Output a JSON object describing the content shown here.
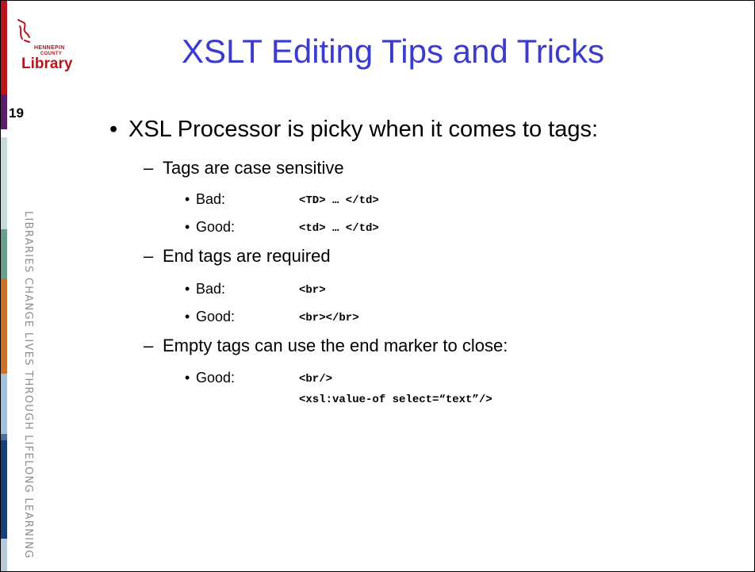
{
  "sidebar": {
    "logo": {
      "line1": "HENNEPIN",
      "line2": "COUNTY",
      "line3": "Library"
    },
    "slide_number": "19",
    "tagline": "LIBRARIES CHANGE LIVES THROUGH LIFELONG LEARNING",
    "colors": {
      "brand_red": "#b9151c",
      "stripes": [
        "#b9151c",
        "#5a1d6b",
        "#c6dcd9",
        "#6b9d8d",
        "#c8722f",
        "#a7bfdc",
        "#4f6fa3",
        "#1b3d7a",
        "#1e2a5a"
      ]
    }
  },
  "title": "XSLT Editing Tips and Tricks",
  "body": {
    "main_bullet": "XSL Processor is picky when it comes to tags:",
    "sections": [
      {
        "heading": "Tags are case sensitive",
        "items": [
          {
            "label": "Bad:",
            "code": "<TD> … </td>"
          },
          {
            "label": "Good:",
            "code": "<td> … </td>"
          }
        ]
      },
      {
        "heading": "End tags are required",
        "items": [
          {
            "label": "Bad:",
            "code": "<br>"
          },
          {
            "label": "Good:",
            "code": "<br></br>"
          }
        ]
      },
      {
        "heading": "Empty tags can use the end marker to close:",
        "items": [
          {
            "label": "Good:",
            "code": "<br/>"
          }
        ],
        "extra_code": "<xsl:value-of select=“text”/>"
      }
    ]
  }
}
